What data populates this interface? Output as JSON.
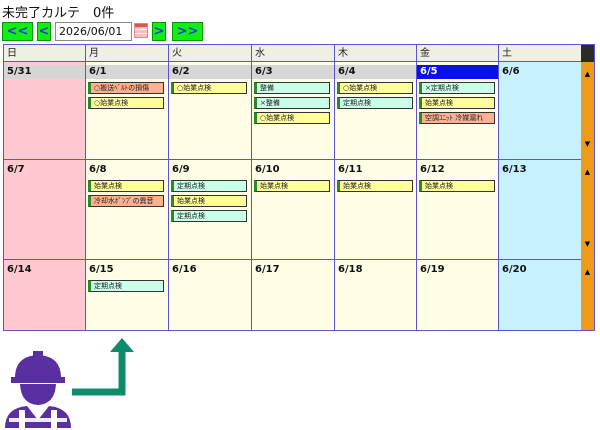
{
  "title": "未完了カルテ　0件",
  "nav": {
    "first": "<<",
    "prev": "<",
    "date": "2026/06/01",
    "next": ">",
    "last": ">>"
  },
  "weekdays": [
    "日",
    "月",
    "火",
    "水",
    "木",
    "金",
    "土"
  ],
  "weeks": [
    {
      "days": [
        {
          "date": "5/31",
          "events": []
        },
        {
          "date": "6/1",
          "events": [
            {
              "label": "○搬送ﾍﾞﾙﾄの損傷",
              "color": "r"
            },
            {
              "label": "○始業点検",
              "color": "y"
            }
          ]
        },
        {
          "date": "6/2",
          "events": [
            {
              "label": "○始業点検",
              "color": "y"
            }
          ]
        },
        {
          "date": "6/3",
          "events": [
            {
              "label": "整備",
              "color": "g"
            },
            {
              "label": "×整備",
              "color": "g"
            },
            {
              "label": "○始業点検",
              "color": "y"
            }
          ]
        },
        {
          "date": "6/4",
          "events": [
            {
              "label": "○始業点検",
              "color": "y"
            },
            {
              "label": "定期点検",
              "color": "g"
            }
          ]
        },
        {
          "date": "6/5",
          "today": true,
          "events": [
            {
              "label": "×定期点検",
              "color": "g"
            },
            {
              "label": "始業点検",
              "color": "y"
            },
            {
              "label": "空調ﾕﾆｯﾄ 冷媒漏れ",
              "color": "r"
            }
          ]
        },
        {
          "date": "6/6",
          "events": []
        }
      ]
    },
    {
      "days": [
        {
          "date": "6/7",
          "events": []
        },
        {
          "date": "6/8",
          "events": [
            {
              "label": "始業点検",
              "color": "y"
            },
            {
              "label": "冷却水ﾎﾟﾝﾌﾟの異音",
              "color": "r"
            }
          ]
        },
        {
          "date": "6/9",
          "events": [
            {
              "label": "定期点検",
              "color": "g"
            },
            {
              "label": "始業点検",
              "color": "y"
            },
            {
              "label": "定期点検",
              "color": "g"
            }
          ]
        },
        {
          "date": "6/10",
          "events": [
            {
              "label": "始業点検",
              "color": "y"
            }
          ]
        },
        {
          "date": "6/11",
          "events": [
            {
              "label": "始業点検",
              "color": "y"
            }
          ]
        },
        {
          "date": "6/12",
          "events": [
            {
              "label": "始業点検",
              "color": "y"
            }
          ]
        },
        {
          "date": "6/13",
          "events": []
        }
      ]
    },
    {
      "days": [
        {
          "date": "6/14",
          "events": []
        },
        {
          "date": "6/15",
          "events": [
            {
              "label": "定期点検",
              "color": "g"
            }
          ]
        },
        {
          "date": "6/16",
          "events": []
        },
        {
          "date": "6/17",
          "events": []
        },
        {
          "date": "6/18",
          "events": []
        },
        {
          "date": "6/19",
          "events": []
        },
        {
          "date": "6/20",
          "events": []
        }
      ]
    }
  ],
  "scroll": {
    "up": "▲",
    "down": "▼"
  },
  "colors": {
    "nav_bg": "#12ee12",
    "today": "#0a10e8",
    "sunday": "#ffc9cf",
    "saturday": "#c8f1ff",
    "weekday": "#fffde6",
    "scrollbar": "#ee9a1a",
    "arrow": "#0f8a6a",
    "worker": "#5a2fa0"
  }
}
